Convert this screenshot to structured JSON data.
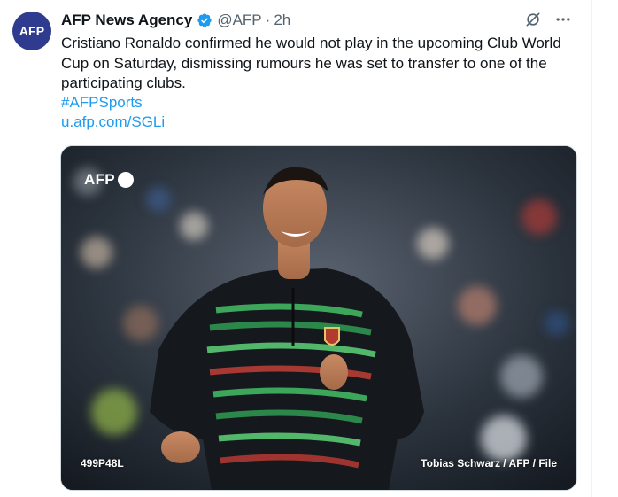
{
  "tweet": {
    "avatar_text": "AFP",
    "author_name": "AFP News Agency",
    "handle": "@AFP",
    "separator": "·",
    "time": "2h",
    "body": "Cristiano Ronaldo confirmed he would not play in the upcoming Club World Cup on Saturday, dismissing rumours he was set to transfer to one of the participating clubs.",
    "hashtag": "#AFPSports",
    "link": "u.afp.com/SGLi"
  },
  "media": {
    "logo_text": "AFP",
    "photo_id": "499P48L",
    "credit": "Tobias Schwarz / AFP / File"
  },
  "colors": {
    "link": "#1d9bf0",
    "verified": "#1d9bf0",
    "secondary_text": "#536471",
    "avatar_bg": "#2f3b8f"
  },
  "icons": [
    "verified-badge-icon",
    "grok-icon",
    "more-icon"
  ]
}
